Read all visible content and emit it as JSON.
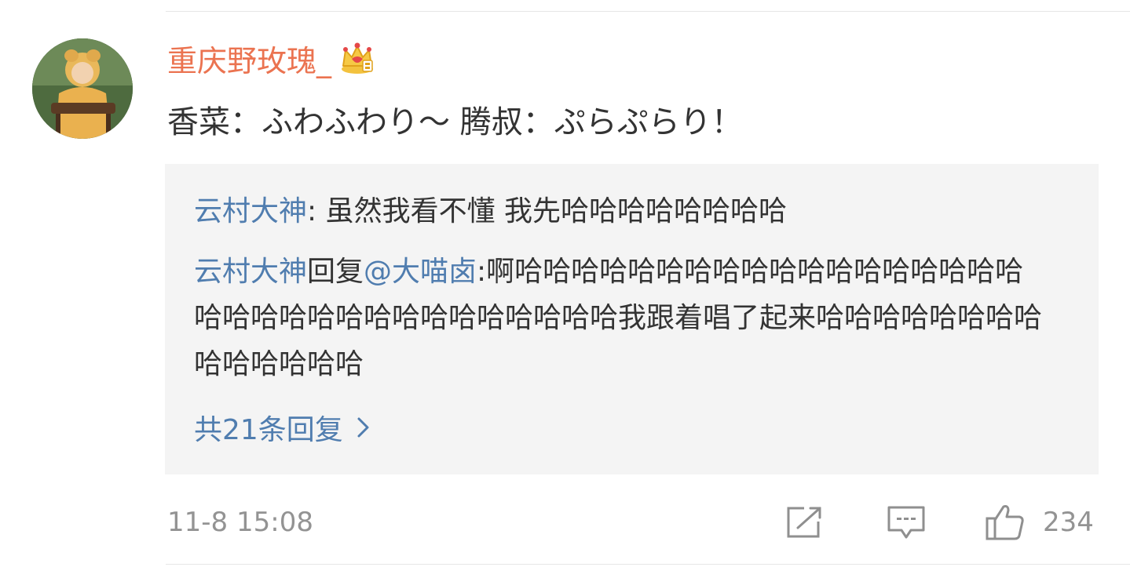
{
  "comment": {
    "username": "重庆野玫瑰_",
    "text": "香菜：ふわふわり～ 腾叔：ぷらぷらり！",
    "timestamp": "11-8 15:08",
    "like_count": "234"
  },
  "replies": [
    {
      "author": "云村大神",
      "separator": ": ",
      "text": "虽然我看不懂 我先哈哈哈哈哈哈哈哈"
    },
    {
      "author": "云村大神",
      "reply_word": "回复",
      "mention": "@大喵卤",
      "text": ":啊哈哈哈哈哈哈哈哈哈哈哈哈哈哈哈哈哈哈哈哈哈哈哈哈哈哈哈哈哈哈哈哈哈我跟着唱了起来哈哈哈哈哈哈哈哈哈哈哈哈哈哈"
    }
  ],
  "more_replies_label": "共21条回复",
  "icons": {
    "badge": "crown-badge-icon",
    "more": "chevron-right-icon",
    "share": "share-icon",
    "comment": "comment-icon",
    "like": "thumbs-up-icon"
  },
  "colors": {
    "username": "#eb7350",
    "link": "#507daf",
    "text": "#333333",
    "meta": "#939393",
    "reply_bg": "#f4f4f4",
    "icon": "#8f8f8f"
  }
}
